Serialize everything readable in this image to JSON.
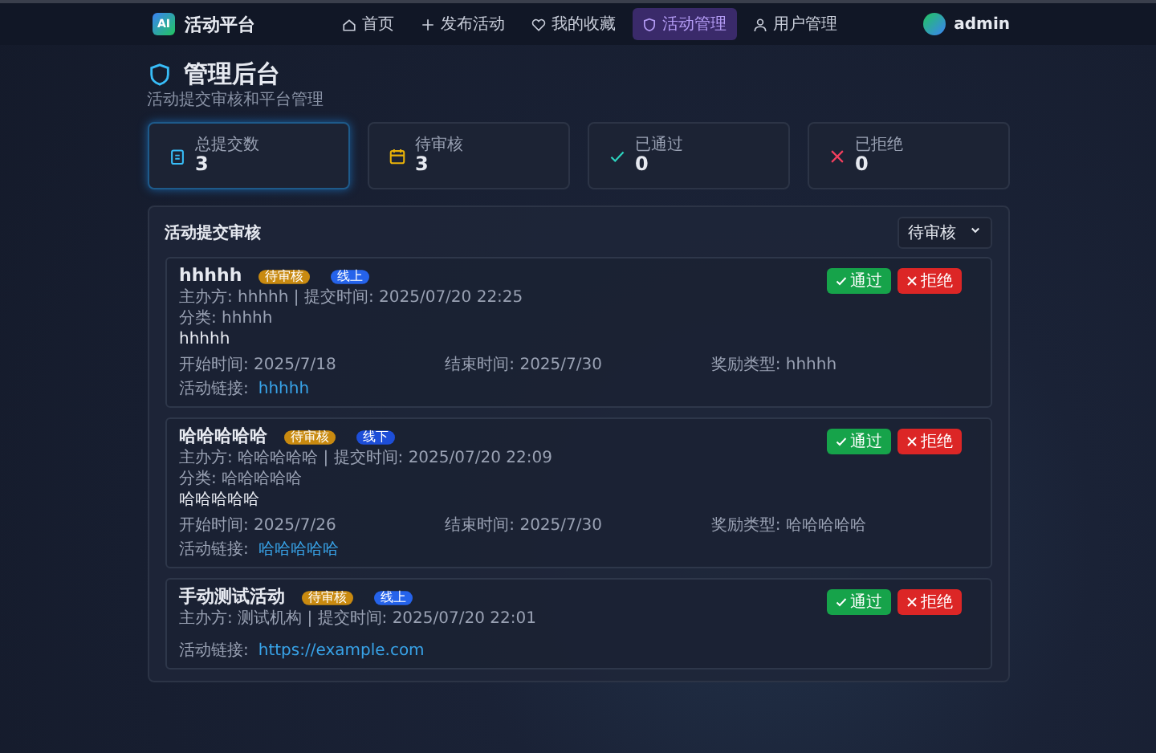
{
  "nav": {
    "logo": "AI",
    "brand": "活动平台",
    "items": [
      {
        "label": "首页",
        "selected": false
      },
      {
        "label": "发布活动",
        "selected": false
      },
      {
        "label": "我的收藏",
        "selected": false
      },
      {
        "label": "活动管理",
        "selected": true
      },
      {
        "label": "用户管理",
        "selected": false
      }
    ],
    "user": "admin"
  },
  "header": {
    "title": "管理后台",
    "subtitle": "活动提交审核和平台管理"
  },
  "stats": [
    {
      "label": "总提交数",
      "value": "3",
      "selected": true
    },
    {
      "label": "待审核",
      "value": "3",
      "selected": false
    },
    {
      "label": "已通过",
      "value": "0",
      "selected": false
    },
    {
      "label": "已拒绝",
      "value": "0",
      "selected": false
    }
  ],
  "review": {
    "title": "活动提交审核",
    "filter": "待审核",
    "submissions": [
      {
        "title": "hhhhh",
        "status": "待审核",
        "mode": "线上",
        "meta": "主办方: hhhhh | 提交时间: 2025/07/20 22:25",
        "category": "分类: hhhhh",
        "description": "hhhhh",
        "start": "开始时间: 2025/7/18",
        "end": "结束时间: 2025/7/30",
        "reward": "奖励类型: hhhhh",
        "link_label": "活动链接:",
        "link": "hhhhh",
        "approve": "通过",
        "reject": "拒绝"
      },
      {
        "title": "哈哈哈哈哈",
        "status": "待审核",
        "mode": "线下",
        "meta": "主办方: 哈哈哈哈哈 | 提交时间: 2025/07/20 22:09",
        "category": "分类: 哈哈哈哈哈",
        "description": "哈哈哈哈哈",
        "start": "开始时间: 2025/7/26",
        "end": "结束时间: 2025/7/30",
        "reward": "奖励类型: 哈哈哈哈哈",
        "link_label": "活动链接:",
        "link": "哈哈哈哈哈",
        "approve": "通过",
        "reject": "拒绝"
      },
      {
        "title": "手动测试活动",
        "status": "待审核",
        "mode": "线上",
        "meta": "主办方: 测试机构 | 提交时间: 2025/07/20 22:01",
        "link_label": "活动链接:",
        "link": "https://example.com",
        "approve": "通过",
        "reject": "拒绝"
      }
    ]
  }
}
